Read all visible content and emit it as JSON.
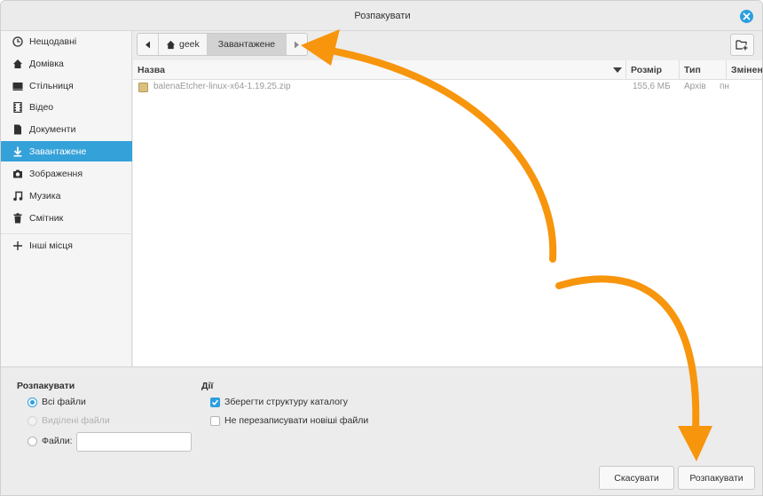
{
  "window": {
    "title": "Розпакувати"
  },
  "sidebar": {
    "items": [
      {
        "label": "Нещодавні",
        "icon": "clock-icon"
      },
      {
        "label": "Домівка",
        "icon": "home-icon"
      },
      {
        "label": "Стільниця",
        "icon": "desktop-icon"
      },
      {
        "label": "Відео",
        "icon": "video-icon"
      },
      {
        "label": "Документи",
        "icon": "document-icon"
      },
      {
        "label": "Завантажене",
        "icon": "download-icon",
        "active": true
      },
      {
        "label": "Зображення",
        "icon": "camera-icon"
      },
      {
        "label": "Музика",
        "icon": "music-icon"
      },
      {
        "label": "Смітник",
        "icon": "trash-icon"
      },
      {
        "label": "Інші місця",
        "icon": "plus-icon"
      }
    ]
  },
  "breadcrumb": {
    "home_label": "geek",
    "current_label": "Завантажене"
  },
  "table": {
    "columns": [
      "Назва",
      "Розмір",
      "Тип",
      "Змінено"
    ],
    "rows": [
      {
        "name": "balenaEtcher-linux-x64-1.19.25.zip",
        "size": "155,6 МБ",
        "type": "Архів",
        "modified": "пн"
      }
    ]
  },
  "extract": {
    "title": "Розпакувати",
    "all_files": "Всі файли",
    "selected_files": "Виділені файли",
    "files_label": "Файли:",
    "files_value": ""
  },
  "actions": {
    "title": "Дії",
    "keep_structure": "Зберегти структуру каталогу",
    "keep_structure_checked": true,
    "no_overwrite": "Не перезаписувати новіші файли",
    "no_overwrite_checked": false
  },
  "buttons": {
    "cancel": "Скасувати",
    "extract": "Розпакувати"
  },
  "colors": {
    "accent": "#35a1d9",
    "annotation_arrow": "#f7950d"
  }
}
